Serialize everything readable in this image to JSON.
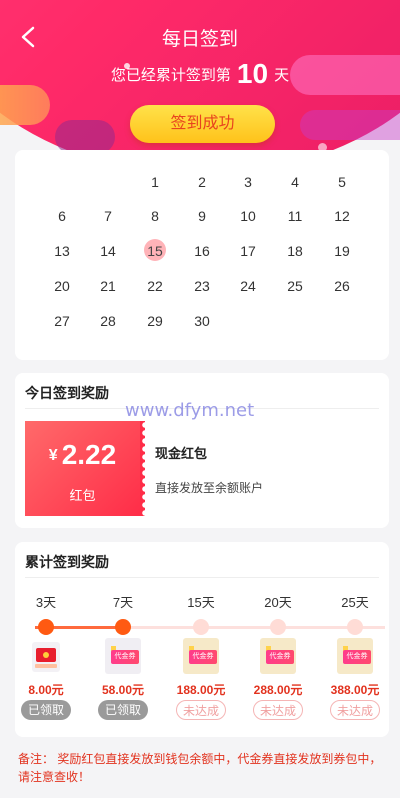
{
  "header": {
    "title": "每日签到",
    "streak_prefix": "您已经累计签到第",
    "streak_days": "10",
    "streak_suffix": "天",
    "signin_button": "签到成功"
  },
  "calendar": {
    "today": "15",
    "rows": [
      [
        "",
        "",
        "1",
        "2",
        "3",
        "4",
        "5",
        "6"
      ],
      [
        "7",
        "8",
        "9",
        "10",
        "11",
        "12",
        "13"
      ],
      [
        "14",
        "15",
        "16",
        "17",
        "18",
        "19",
        "20"
      ],
      [
        "21",
        "22",
        "23",
        "24",
        "25",
        "26",
        "27"
      ],
      [
        "28",
        "29",
        "30"
      ]
    ]
  },
  "today_reward": {
    "section_title": "今日签到奖励",
    "currency": "¥",
    "amount": "2.22",
    "ticket_label": "红包",
    "name": "现金红包",
    "description": "直接发放至余额账户"
  },
  "watermark": "www.dfym.net",
  "cumulative": {
    "section_title": "累计签到奖励",
    "milestones": [
      {
        "day": "3天",
        "amount": "8.00元",
        "status": "已领取",
        "kind": "redpacket",
        "reached": true
      },
      {
        "day": "7天",
        "amount": "58.00元",
        "status": "已领取",
        "kind": "coupon",
        "coupon_label": "代金券",
        "reached": true
      },
      {
        "day": "15天",
        "amount": "188.00元",
        "status": "未达成",
        "kind": "coupon",
        "coupon_label": "代金券",
        "reached": false
      },
      {
        "day": "20天",
        "amount": "288.00元",
        "status": "未达成",
        "kind": "coupon",
        "coupon_label": "代金券",
        "reached": false
      },
      {
        "day": "25天",
        "amount": "388.00元",
        "status": "未达成",
        "kind": "coupon",
        "coupon_label": "代金券",
        "reached": false
      }
    ]
  },
  "note": "备注：  奖励红包直接发放到钱包余额中，代金券直接发放到券包中，请注意查收！",
  "colors": {
    "brand": "#ff2a68",
    "button": "#ffc21a",
    "accent_text": "#e2321e"
  }
}
